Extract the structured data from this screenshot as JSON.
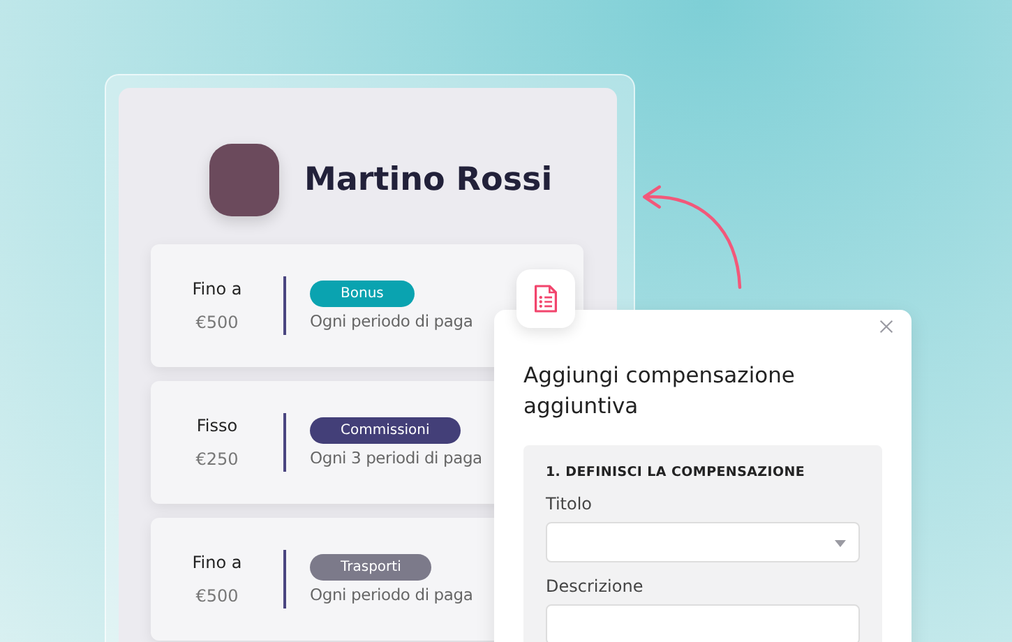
{
  "profile": {
    "name": "Martino Rossi"
  },
  "compensations": [
    {
      "condition": "Fino a",
      "amount": "€500",
      "tag": "Bonus",
      "color": "#0aa3b0",
      "frequency": "Ogni periodo di paga"
    },
    {
      "condition": "Fisso",
      "amount": "€250",
      "tag": "Commissioni",
      "color": "#433f78",
      "frequency": "Ogni 3 periodi di paga"
    },
    {
      "condition": "Fino a",
      "amount": "€500",
      "tag": "Trasporti",
      "color": "#7c7a8a",
      "frequency": "Ogni periodo di paga"
    }
  ],
  "dialog": {
    "title": "Aggiungi compensazione aggiuntiva",
    "section": {
      "heading": "1. DEFINISCI LA COMPENSAZIONE",
      "fields": [
        {
          "kind": "select",
          "label": "Titolo"
        },
        {
          "kind": "text",
          "label": "Descrizione"
        }
      ]
    }
  }
}
